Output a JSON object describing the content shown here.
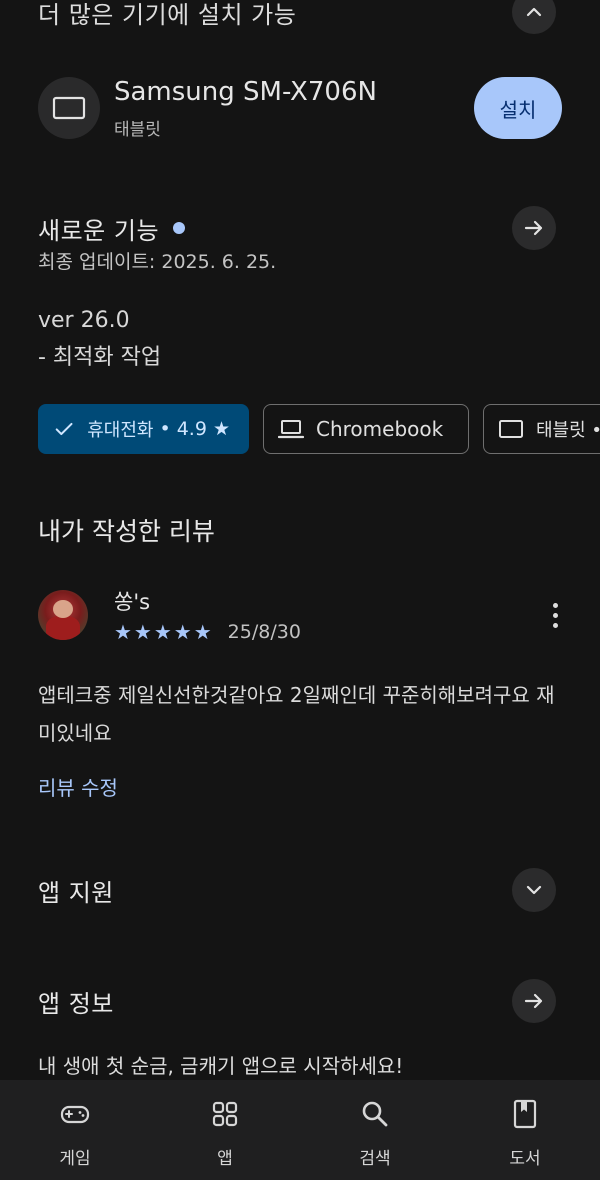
{
  "install_more_devices": {
    "title": "더 많은 기기에 설치 가능",
    "toggle_icon": "chevron-up-icon"
  },
  "device": {
    "icon": "tablet-icon",
    "name": "Samsung SM-X706N",
    "type": "태블릿",
    "install_label": "설치"
  },
  "whats_new": {
    "title": "새로운 기능",
    "updated": "최종 업데이트: 2025. 6. 25.",
    "version": "ver 26.0",
    "note": "- 최적화 작업",
    "arrow_icon": "arrow-right-icon"
  },
  "chips": {
    "phone": {
      "label": "휴대전화",
      "rating": "• 4.9 ★",
      "icon": "check-icon"
    },
    "chromebook": {
      "label": "Chromebook",
      "icon": "laptop-icon"
    },
    "tablet": {
      "label": "태블릿 •",
      "icon": "tablet-icon"
    }
  },
  "my_review": {
    "title": "내가 작성한 리뷰",
    "reviewer_name": "쏭's",
    "stars": "★★★★★",
    "rating": 5,
    "date": "25/8/30",
    "text": "앱테크중 제일신선한것같아요 2일째인데 꾸준히해보려구요 재미있네요",
    "edit_label": "리뷰 수정"
  },
  "app_support": {
    "title": "앱 지원",
    "toggle_icon": "chevron-down-icon"
  },
  "app_info": {
    "title": "앱 정보",
    "arrow_icon": "arrow-right-icon",
    "description": "내 생애 첫 순금, 금캐기 앱으로 시작하세요!"
  },
  "bottom_nav": {
    "items": [
      {
        "label": "게임",
        "icon": "gamepad-icon"
      },
      {
        "label": "앱",
        "icon": "apps-grid-icon"
      },
      {
        "label": "검색",
        "icon": "search-icon"
      },
      {
        "label": "도서",
        "icon": "book-icon"
      }
    ]
  },
  "colors": {
    "background": "#141414",
    "accent": "#a8c7fa",
    "selected_chip": "#004a77",
    "nav_bar": "#1f1f20"
  }
}
